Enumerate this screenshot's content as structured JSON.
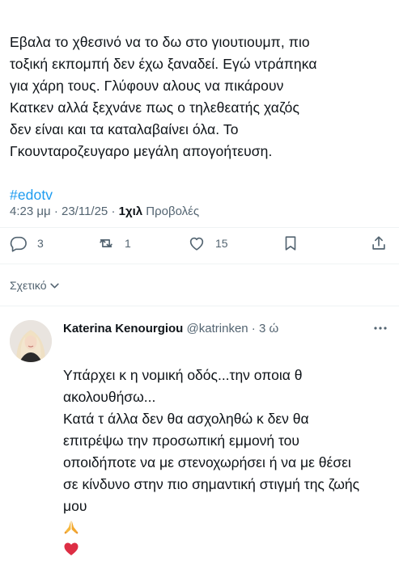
{
  "tweet": {
    "text": "Εβαλα το χθεσινό να το δω στο γιουτιουμπ, πιο\nτοξική εκπομπή δεν έχω ξαναδεί. Εγώ ντράπηκα\nγια χάρη τους. Γλύφουν αλους να πικάρουν\nΚατκεν αλλά ξεχνάνε  πως ο τηλεθεατής χαζός\nδεν είναι και τα καταλαβαίνει όλα. Το\nΓκουνταροζευγαρο μεγάλη απογοήτευση.",
    "hashtag": "#edotv",
    "time": "4:23 μμ",
    "separator": " · ",
    "date": "23/11/25",
    "views_count": "1χιλ",
    "views_label": " Προβολές"
  },
  "actions": {
    "replies": "3",
    "retweets": "1",
    "likes": "15"
  },
  "related": {
    "label": "Σχετικό"
  },
  "reply": {
    "name": "Katerina Kenourgiou",
    "handle": "@katrinken",
    "separator": " · ",
    "time": "3 ώ",
    "text": "Υπάρχει κ η νομική οδός...την οποια θ\nακολουθήσω...\nΚατά τ άλλα δεν θα ασχοληθώ κ δεν θα\nεπιτρέψω την προσωπική εμμονή του\nοποιδήποτε να με στενοχωρήσει ή να με θέσει\nσε κίνδυνο στην πιο σημαντική στιγμή της ζωής\nμου "
  },
  "colors": {
    "accent": "#1d9bf0",
    "muted": "#536471",
    "text": "#0f1419",
    "divider": "#eff3f4"
  },
  "icons": [
    "reply-icon",
    "retweet-icon",
    "like-icon",
    "bookmark-icon",
    "share-icon",
    "chevron-down-icon",
    "more-icon",
    "praying-hands-emoji",
    "red-heart-emoji"
  ]
}
